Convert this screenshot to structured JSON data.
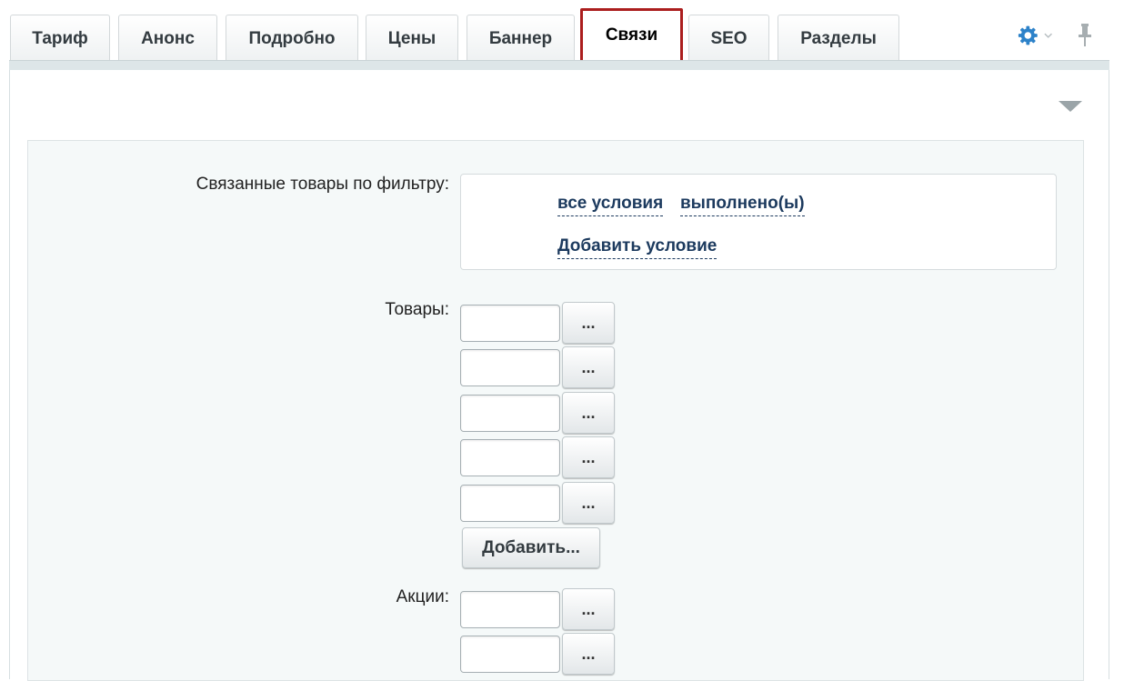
{
  "tabs": [
    {
      "label": "Тариф"
    },
    {
      "label": "Анонс"
    },
    {
      "label": "Подробно"
    },
    {
      "label": "Цены"
    },
    {
      "label": "Баннер"
    },
    {
      "label": "Связи",
      "active": true
    },
    {
      "label": "SEO"
    },
    {
      "label": "Разделы"
    }
  ],
  "icons": {
    "settings": "gear-icon",
    "pin": "pin-icon",
    "collapse": "triangle-down-icon"
  },
  "colors": {
    "active_tab_border": "#ab1e1e",
    "link": "#1c3a5e",
    "gear": "#2d82c9"
  },
  "filter": {
    "label": "Связанные товары по фильтру:",
    "condition_all": "все условия",
    "condition_done": "выполнено(ы)",
    "add_condition": "Добавить условие"
  },
  "products": {
    "label": "Товары:",
    "fields": [
      "",
      "",
      "",
      "",
      ""
    ],
    "dots_label": "...",
    "add_label": "Добавить..."
  },
  "promos": {
    "label": "Акции:",
    "fields": [
      "",
      ""
    ],
    "dots_label": "..."
  }
}
